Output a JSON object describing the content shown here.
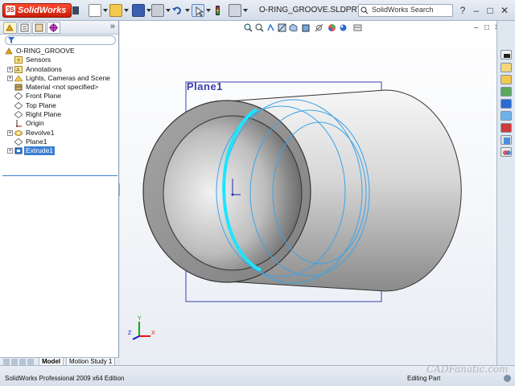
{
  "app": {
    "logo_text": "SolidWorks",
    "window_title": "O-RING_GROOVE.SLDPRT *",
    "search_placeholder": "SolidWorks Search",
    "window_controls": [
      "?",
      "–",
      "□",
      "✕"
    ]
  },
  "toolbar": {
    "icons": [
      "new-file-icon",
      "open-file-icon",
      "save-icon",
      "print-icon",
      "undo-icon",
      "select-icon",
      "rebuild-icon",
      "options-icon"
    ]
  },
  "feature_tree": {
    "panel_tabs": [
      "featuremanager-tab",
      "propertymanager-tab",
      "configurationmanager-tab",
      "dimxpert-tab"
    ],
    "expand_glyph": "»",
    "items": [
      {
        "label": "O-RING_GROOVE",
        "icon": "part-icon",
        "expandable": false,
        "root": true
      },
      {
        "label": "Sensors",
        "icon": "sensor-icon",
        "expandable": false
      },
      {
        "label": "Annotations",
        "icon": "annotations-icon",
        "expandable": true
      },
      {
        "label": "Lights, Cameras and Scene",
        "icon": "lights-icon",
        "expandable": true
      },
      {
        "label": "Material <not specified>",
        "icon": "material-icon",
        "expandable": false
      },
      {
        "label": "Front Plane",
        "icon": "plane-icon",
        "expandable": false
      },
      {
        "label": "Top Plane",
        "icon": "plane-icon",
        "expandable": false
      },
      {
        "label": "Right Plane",
        "icon": "plane-icon",
        "expandable": false
      },
      {
        "label": "Origin",
        "icon": "origin-icon",
        "expandable": false
      },
      {
        "label": "Revolve1",
        "icon": "revolve-icon",
        "expandable": true
      },
      {
        "label": "Plane1",
        "icon": "plane-icon",
        "expandable": false
      },
      {
        "label": "Extrude1",
        "icon": "extrude-icon",
        "expandable": true,
        "selected": true
      }
    ],
    "bottom_tabs": [
      "Model",
      "Motion Study 1"
    ],
    "active_bottom_tab": "Model"
  },
  "viewport": {
    "plane_label": "Plane1",
    "viewport_controls": [
      "–",
      "□",
      "✕"
    ],
    "triad": {
      "x": "X",
      "y": "Y",
      "z": "Z"
    }
  },
  "task_pane": {
    "icons": [
      "resources-icon",
      "design-library-icon",
      "file-explorer-icon",
      "search-results-icon",
      "view-palette-icon",
      "appearances-icon",
      "custom-properties-icon",
      "toolbox-icon",
      "forum-icon"
    ]
  },
  "status": {
    "left_text": "SolidWorks Professional 2009 x64 Edition",
    "right_text": "Editing Part",
    "watermark": "CADFanatic.com"
  },
  "colors": {
    "accent": "#3c7fd3",
    "logo_red": "#c81d0a",
    "plane_outline": "#3a3fa8",
    "sketch_blue": "#3aa4e8",
    "highlight_cyan": "#1ae6ff"
  }
}
